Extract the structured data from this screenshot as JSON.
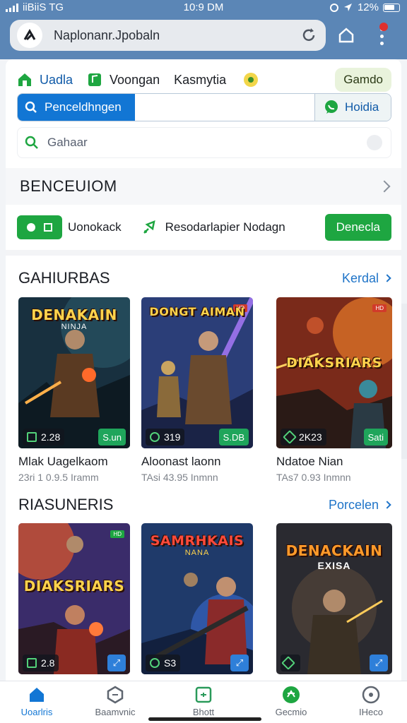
{
  "status_bar": {
    "carrier": "iiBiiS TG",
    "time": "10:9 DM",
    "battery": "12%"
  },
  "browser": {
    "url": "Naplonanr.Jpobaln",
    "icons": [
      "site-logo-icon",
      "reload-icon",
      "home-icon",
      "menu-dots-icon"
    ]
  },
  "nav_chips": [
    {
      "label": "Uadla",
      "icon": "house-icon"
    },
    {
      "label": "Voongan",
      "icon": "note-icon"
    },
    {
      "label": "Kasmytia",
      "icon": "smiley-icon"
    }
  ],
  "pill_button": "Gamdo",
  "search": {
    "button_label": "Penceldhngen",
    "side_label": "Hoidia"
  },
  "filter": {
    "placeholder": "Gahaar"
  },
  "section_title": "BENCEUIOM",
  "actions": {
    "first_label": "Uonokack",
    "second_label": "Resodarlapier Nodagn",
    "button_label": "Denecla"
  },
  "list1": {
    "title": "GAHIURBAS",
    "more": "Kerdal",
    "games": [
      {
        "art_title": "DENAKAIN",
        "art_sub": "NINJA",
        "count": "2.28",
        "badge": "S.un",
        "name": "Mlak Uagelkaom",
        "meta": "23ri 1 0.9.5 Iramm",
        "theme": "a"
      },
      {
        "art_title": "DONGT AIMAN",
        "art_sub": "",
        "count": "319",
        "badge": "S.DB",
        "name": "Aloonast laonn",
        "meta": "TAsi 43.95 Inmnn",
        "theme": "b",
        "tag": "HD"
      },
      {
        "art_title": "DIAKSRIARS",
        "art_sub": "",
        "count": "2K23",
        "badge": "Sati",
        "name": "Ndatoe Nian",
        "meta": "TAs7 0.93 Inmnn",
        "theme": "c",
        "tag": "HD"
      }
    ]
  },
  "list2": {
    "title": "RIASUNERIS",
    "more": "Porcelen",
    "games": [
      {
        "art_title": "DIAKSRIARS",
        "art_sub": "",
        "count": "2.8",
        "theme": "d",
        "tag": "HD"
      },
      {
        "art_title": "SAMRHKAIS",
        "art_sub": "NANA",
        "count": "S3",
        "theme": "e"
      },
      {
        "art_title": "DENACKAIN",
        "art_sub": "EXISA",
        "count": "",
        "theme": "f"
      }
    ]
  },
  "bottom_nav": [
    {
      "label": "Uoarlris",
      "icon": "home-icon",
      "active": true
    },
    {
      "label": "Baamvnic",
      "icon": "puzzle-icon",
      "active": false
    },
    {
      "label": "Bhott",
      "icon": "card-icon",
      "active": false
    },
    {
      "label": "Gecmio",
      "icon": "star-icon",
      "active": false
    },
    {
      "label": "IHeco",
      "icon": "compass-icon",
      "active": false
    }
  ],
  "colors": {
    "accent_blue": "#1276d4",
    "accent_green": "#1ea641",
    "header_blue": "#5b86b6"
  }
}
